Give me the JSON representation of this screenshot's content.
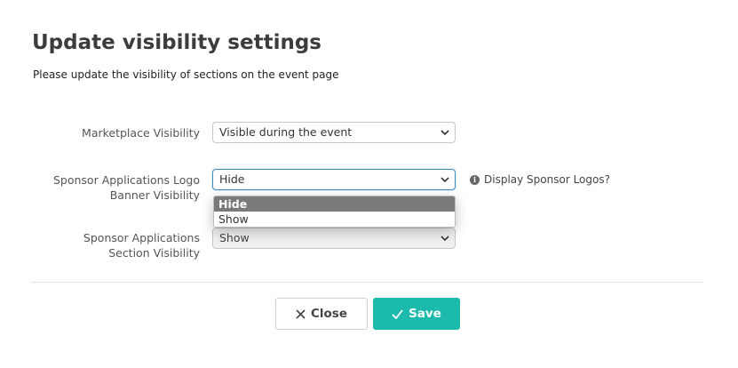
{
  "modal": {
    "title": "Update visibility settings",
    "subtitle": "Please update the visibility of sections on the event page"
  },
  "fields": {
    "marketplace": {
      "label": "Marketplace Visibility",
      "value": "Visible during the event"
    },
    "sponsor_logo": {
      "label_line1": "Sponsor Applications Logo",
      "label_line2": "Banner Visibility",
      "value": "Hide",
      "help_text": "Display Sponsor Logos?",
      "options": [
        "Hide",
        "Show"
      ]
    },
    "sponsor_section": {
      "label_line1": "Sponsor Applications",
      "label_line2": "Section Visibility",
      "value": "Show"
    }
  },
  "footer": {
    "close_label": "Close",
    "save_label": "Save"
  },
  "colors": {
    "save_bg": "#1cb9ad",
    "focus_border": "#3d8fc6",
    "selected_option_bg": "#7a7a7a"
  },
  "icons": {
    "close": "close-icon",
    "save": "check-icon",
    "info": "info-icon",
    "chevron": "chevron-down-icon"
  }
}
